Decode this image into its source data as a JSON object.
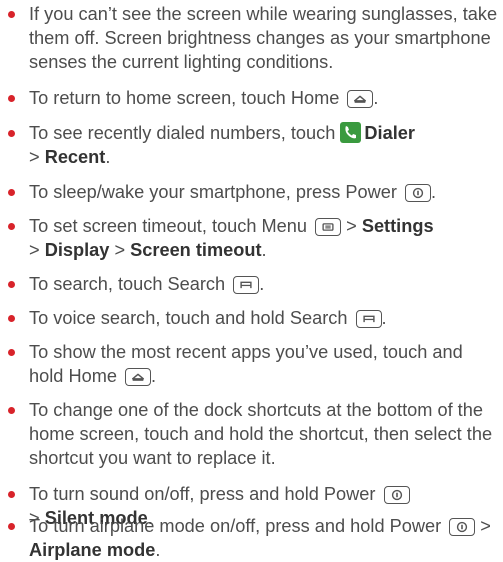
{
  "tips": [
    {
      "before": "If you can’t see the screen while wearing sunglasses, take them off. Screen brightness changes as your smartphone senses the current lighting conditions."
    },
    {
      "before": "To return to home screen, touch Home",
      "key": "home-key-icon",
      "after": "."
    },
    {
      "before": "To see recently dialed numbers, touch ",
      "icon": "dialer-app-icon",
      "bold1": "Dialer",
      "line2_sep": "> ",
      "bold2": "Recent",
      "after": "."
    },
    {
      "before": "To sleep/wake your smartphone, press Power",
      "key": "power-key-icon",
      "after": "."
    },
    {
      "before": "To set screen timeout, touch Menu",
      "key": "menu-key-icon",
      "sep1": " > ",
      "bold1": "Settings",
      "sep2": "> ",
      "bold2": "Display",
      "sep3": " > ",
      "bold3": "Screen timeout",
      "after": "."
    },
    {
      "before": "To search, touch Search",
      "key": "search-key-icon",
      "after": "."
    },
    {
      "before": "To voice search, touch and hold Search",
      "key": "search-key-icon",
      "after": "."
    },
    {
      "before": "To show the most recent apps you’ve used, touch and hold Home",
      "key": "home-key-icon",
      "after": "."
    },
    {
      "before": "To change one of the dock shortcuts at the bottom of the home screen, touch and hold the shortcut, then select the shortcut you want to replace it."
    },
    {
      "before": "To turn sound on/off, press and hold Power",
      "key": "power-key-icon",
      "sep": "> ",
      "bold": "Silent mode",
      "after": "."
    },
    {
      "before": "To turn airplane mode on/off, press and hold Power",
      "key": "power-key-icon",
      "sep": " > ",
      "bold": "Airplane mode",
      "after": "."
    }
  ],
  "colors": {
    "bullet": "#d8232a",
    "text": "#4d4d4d",
    "dialer_icon": "#3a9a3f"
  }
}
